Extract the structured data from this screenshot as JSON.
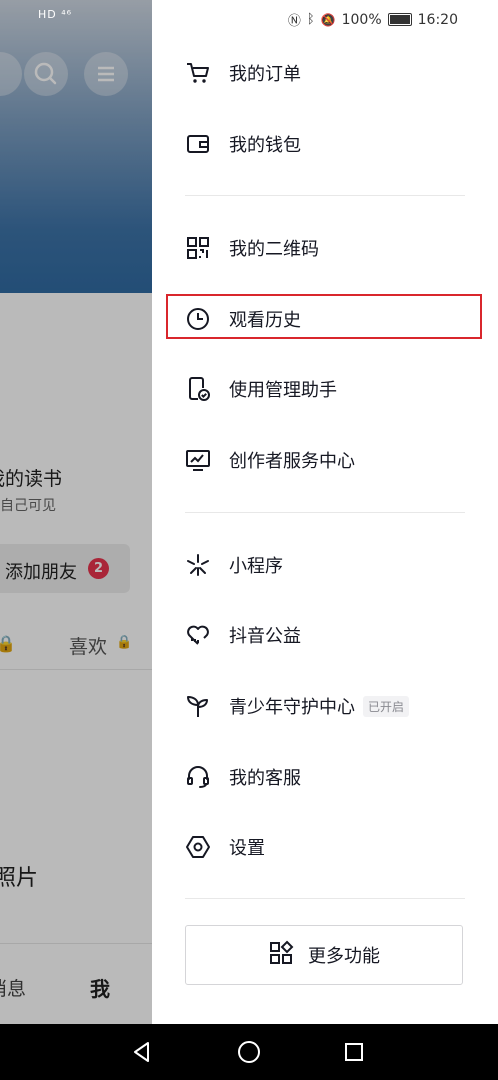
{
  "status_bar": {
    "left": "HD ⁴⁶",
    "right_battery": "100%",
    "time": "16:20"
  },
  "background_page": {
    "reading_title": "我的读书",
    "reading_sub": "仅自己可见",
    "add_friend": "添加朋友",
    "add_friend_badge": "2",
    "likes_tab": "喜欢",
    "photos": "照片",
    "nav_messages": "消息",
    "nav_me": "我"
  },
  "drawer": {
    "items": [
      {
        "label": "我的订单",
        "icon": "cart-icon"
      },
      {
        "label": "我的钱包",
        "icon": "wallet-icon"
      },
      {
        "label": "我的二维码",
        "icon": "qr-code-icon"
      },
      {
        "label": "观看历史",
        "icon": "clock-icon"
      },
      {
        "label": "使用管理助手",
        "icon": "phone-check-icon"
      },
      {
        "label": "创作者服务中心",
        "icon": "monitor-chart-icon"
      },
      {
        "label": "小程序",
        "icon": "mini-program-icon"
      },
      {
        "label": "抖音公益",
        "icon": "charity-heart-icon"
      },
      {
        "label": "青少年守护中心",
        "icon": "sprout-icon",
        "tag": "已开启"
      },
      {
        "label": "我的客服",
        "icon": "headset-icon"
      },
      {
        "label": "设置",
        "icon": "settings-hexagon-icon"
      }
    ],
    "more_button": "更多功能"
  },
  "colors": {
    "highlight": "#d9262c",
    "text": "#161823",
    "badge": "#e8344e"
  }
}
